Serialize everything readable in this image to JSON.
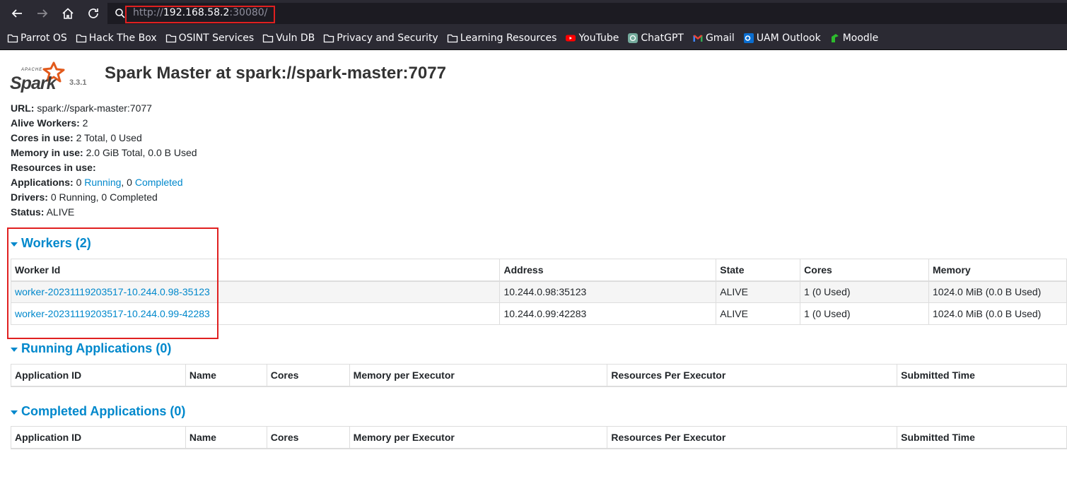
{
  "browser": {
    "url_scheme": "http://",
    "url_host": "192.168.58.2",
    "url_port": ":30080/",
    "bookmarks": [
      {
        "label": "Parrot OS",
        "icon": "folder-icon"
      },
      {
        "label": "Hack The Box",
        "icon": "folder-icon"
      },
      {
        "label": "OSINT Services",
        "icon": "folder-icon"
      },
      {
        "label": "Vuln DB",
        "icon": "folder-icon"
      },
      {
        "label": "Privacy and Security",
        "icon": "folder-icon"
      },
      {
        "label": "Learning Resources",
        "icon": "folder-icon"
      },
      {
        "label": "YouTube",
        "icon": "youtube-icon"
      },
      {
        "label": "ChatGPT",
        "icon": "chatgpt-icon"
      },
      {
        "label": "Gmail",
        "icon": "gmail-icon"
      },
      {
        "label": "UAM Outlook",
        "icon": "outlook-icon"
      },
      {
        "label": "Moodle",
        "icon": "moodle-icon"
      }
    ]
  },
  "header": {
    "version": "3.3.1",
    "title": "Spark Master at spark://spark-master:7077"
  },
  "summary": {
    "url_label": "URL:",
    "url_value": "spark://spark-master:7077",
    "alive_workers_label": "Alive Workers:",
    "alive_workers_value": "2",
    "cores_label": "Cores in use:",
    "cores_value": "2 Total, 0 Used",
    "memory_label": "Memory in use:",
    "memory_value": "2.0 GiB Total, 0.0 B Used",
    "resources_label": "Resources in use:",
    "applications_label": "Applications:",
    "applications_running_count": "0",
    "applications_running_link": "Running",
    "applications_sep": ", 0",
    "applications_completed_link": "Completed",
    "drivers_label": "Drivers:",
    "drivers_value": "0 Running, 0 Completed",
    "status_label": "Status:",
    "status_value": "ALIVE"
  },
  "workers": {
    "heading": "Workers (2)",
    "columns": [
      "Worker Id",
      "Address",
      "State",
      "Cores",
      "Memory"
    ],
    "rows": [
      {
        "id": "worker-20231119203517-10.244.0.98-35123",
        "address": "10.244.0.98:35123",
        "state": "ALIVE",
        "cores": "1 (0 Used)",
        "memory": "1024.0 MiB (0.0 B Used)"
      },
      {
        "id": "worker-20231119203517-10.244.0.99-42283",
        "address": "10.244.0.99:42283",
        "state": "ALIVE",
        "cores": "1 (0 Used)",
        "memory": "1024.0 MiB (0.0 B Used)"
      }
    ]
  },
  "running_apps": {
    "heading": "Running Applications (0)",
    "columns": [
      "Application ID",
      "Name",
      "Cores",
      "Memory per Executor",
      "Resources Per Executor",
      "Submitted Time"
    ]
  },
  "completed_apps": {
    "heading": "Completed Applications (0)",
    "columns": [
      "Application ID",
      "Name",
      "Cores",
      "Memory per Executor",
      "Resources Per Executor",
      "Submitted Time"
    ]
  },
  "colors": {
    "link": "#0088cc",
    "highlight": "#e02020",
    "browser_bg": "#2b2a33"
  }
}
